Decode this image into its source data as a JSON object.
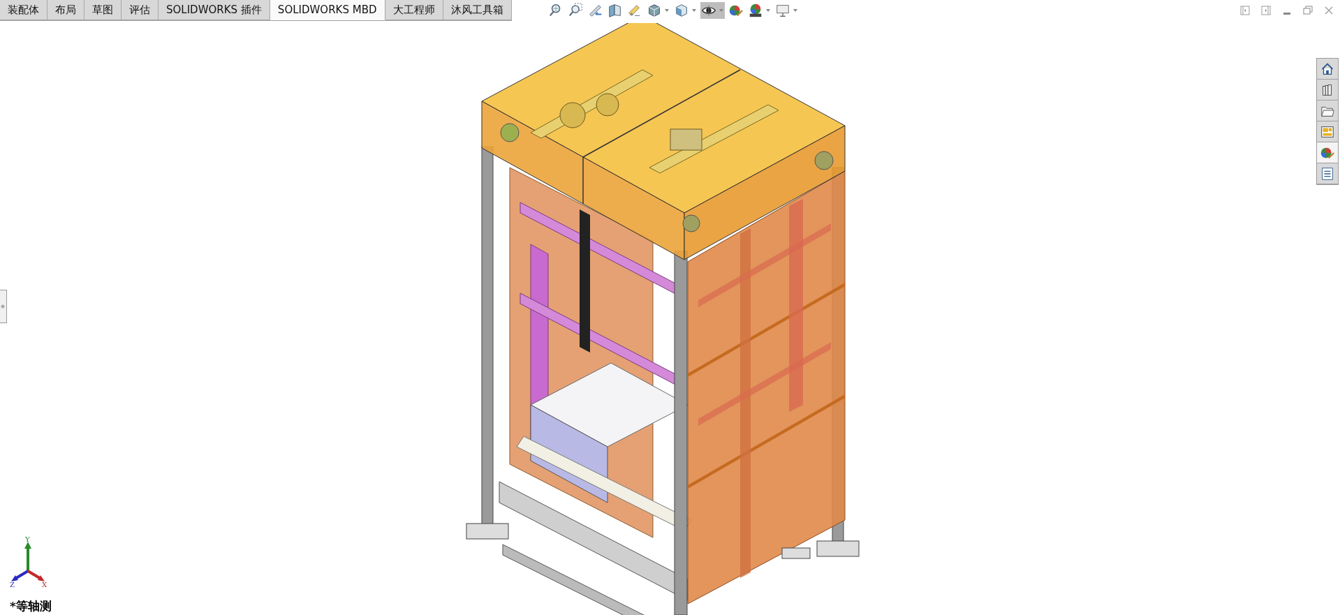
{
  "tabs": [
    {
      "label": "装配体",
      "selected": false
    },
    {
      "label": "布局",
      "selected": false
    },
    {
      "label": "草图",
      "selected": false
    },
    {
      "label": "评估",
      "selected": false
    },
    {
      "label": "SOLIDWORKS 插件",
      "selected": false
    },
    {
      "label": "SOLIDWORKS MBD",
      "selected": true
    },
    {
      "label": "大工程师",
      "selected": false
    },
    {
      "label": "沐风工具箱",
      "selected": false
    }
  ],
  "view_toolbar": [
    {
      "kind": "zoomfit",
      "dropdown": false,
      "pressed": false
    },
    {
      "kind": "zoomarea",
      "dropdown": false,
      "pressed": false
    },
    {
      "kind": "previous",
      "dropdown": false,
      "pressed": false
    },
    {
      "kind": "section",
      "dropdown": false,
      "pressed": false
    },
    {
      "kind": "annotation",
      "dropdown": false,
      "pressed": false
    },
    {
      "kind": "orientation",
      "dropdown": true,
      "pressed": false
    },
    {
      "kind": "display",
      "dropdown": true,
      "pressed": false
    },
    {
      "kind": "hideshow",
      "dropdown": true,
      "pressed": true
    },
    {
      "kind": "appearance",
      "dropdown": false,
      "pressed": false
    },
    {
      "kind": "scene",
      "dropdown": true,
      "pressed": false
    },
    {
      "kind": "monitor",
      "dropdown": true,
      "pressed": false
    }
  ],
  "window_controls": [
    {
      "kind": "dockleft"
    },
    {
      "kind": "dockright"
    },
    {
      "kind": "minimize"
    },
    {
      "kind": "restore"
    },
    {
      "kind": "close"
    }
  ],
  "task_pane": [
    {
      "kind": "home",
      "selected": false
    },
    {
      "kind": "library",
      "selected": false
    },
    {
      "kind": "folder",
      "selected": false
    },
    {
      "kind": "palette",
      "selected": false
    },
    {
      "kind": "appearance",
      "selected": true
    },
    {
      "kind": "properties",
      "selected": false
    }
  ],
  "triad": {
    "y": "Y",
    "z": "Z",
    "x": "X"
  },
  "view_label": "*等轴测"
}
